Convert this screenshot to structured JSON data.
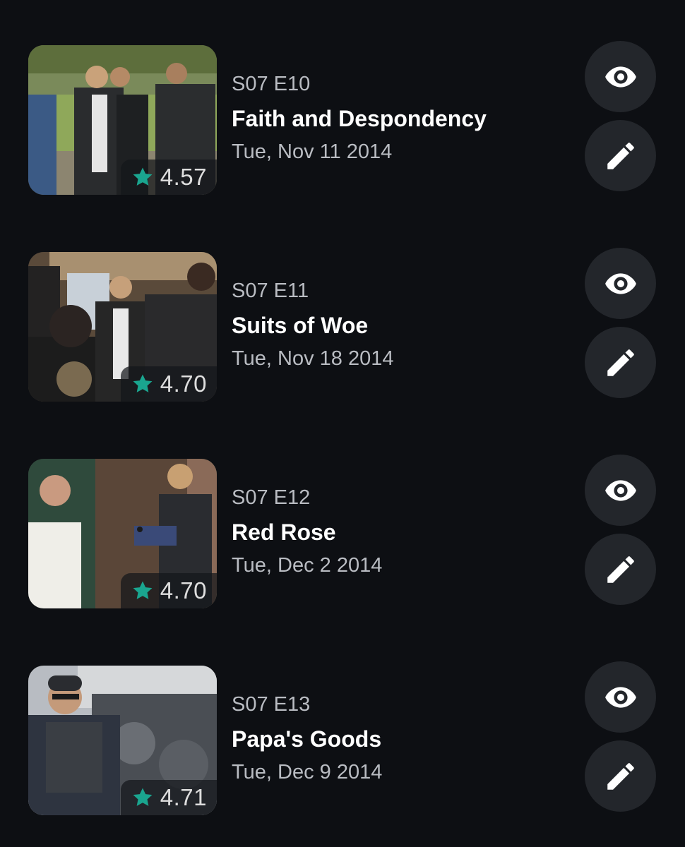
{
  "colors": {
    "background": "#0d0f13",
    "button_bg": "#23262b",
    "star": "#1aa58f",
    "text_primary": "#ffffff",
    "text_secondary": "#b9bcc2"
  },
  "episodes": [
    {
      "code": "S07 E10",
      "title": "Faith and Despondency",
      "date": "Tue, Nov 11 2014",
      "rating": "4.57",
      "rating_icon": "star-icon",
      "watch_icon": "eye-icon",
      "edit_icon": "pencil-icon"
    },
    {
      "code": "S07 E11",
      "title": "Suits of Woe",
      "date": "Tue, Nov 18 2014",
      "rating": "4.70",
      "rating_icon": "star-icon",
      "watch_icon": "eye-icon",
      "edit_icon": "pencil-icon"
    },
    {
      "code": "S07 E12",
      "title": "Red Rose",
      "date": "Tue, Dec 2 2014",
      "rating": "4.70",
      "rating_icon": "star-icon",
      "watch_icon": "eye-icon",
      "edit_icon": "pencil-icon"
    },
    {
      "code": "S07 E13",
      "title": "Papa's Goods",
      "date": "Tue, Dec 9 2014",
      "rating": "4.71",
      "rating_icon": "star-icon",
      "watch_icon": "eye-icon",
      "edit_icon": "pencil-icon"
    }
  ]
}
